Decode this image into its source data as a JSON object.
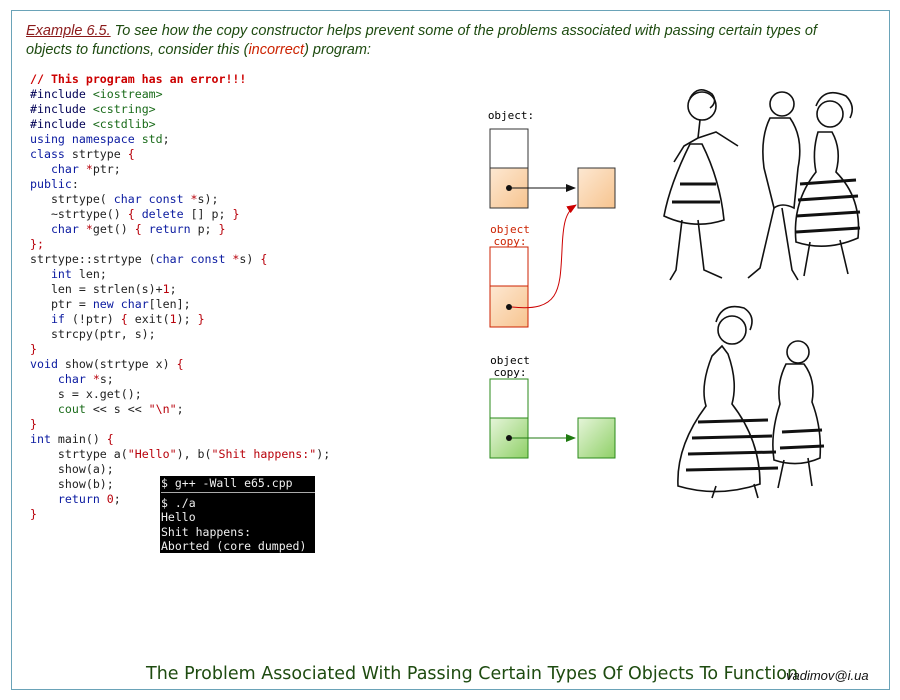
{
  "intro": {
    "example": "Example 6.5.",
    "text_before": " To see how the copy constructor helps prevent some of the problems associated with passing certain types of objects to functions, consider this (",
    "incorrect": "incorrect",
    "text_after": ") program:"
  },
  "code_lines": [
    [
      {
        "c": "c-comment",
        "t": "// This program has an error!!!"
      }
    ],
    [
      {
        "c": "c-pp",
        "t": "#include "
      },
      {
        "c": "c-hdr",
        "t": "<iostream>"
      }
    ],
    [
      {
        "c": "c-pp",
        "t": "#include "
      },
      {
        "c": "c-hdr",
        "t": "<cstring>"
      }
    ],
    [
      {
        "c": "c-pp",
        "t": "#include "
      },
      {
        "c": "c-hdr",
        "t": "<cstdlib>"
      }
    ],
    [
      {
        "c": "c-kw",
        "t": "using namespace "
      },
      {
        "c": "c-hdr",
        "t": "std"
      },
      {
        "c": "",
        "t": ";"
      }
    ],
    [
      {
        "c": "c-kw",
        "t": "class "
      },
      {
        "c": "",
        "t": "strtype "
      },
      {
        "c": "c-str",
        "t": "{"
      }
    ],
    [
      {
        "c": "",
        "t": "   "
      },
      {
        "c": "c-type",
        "t": "char "
      },
      {
        "c": "c-str",
        "t": "*"
      },
      {
        "c": "",
        "t": "ptr;"
      }
    ],
    [
      {
        "c": "c-kw",
        "t": "public"
      },
      {
        "c": "",
        "t": ":"
      }
    ],
    [
      {
        "c": "",
        "t": "   strtype( "
      },
      {
        "c": "c-type",
        "t": "char const "
      },
      {
        "c": "c-str",
        "t": "*"
      },
      {
        "c": "",
        "t": "s);"
      }
    ],
    [
      {
        "c": "",
        "t": "   ~strtype() "
      },
      {
        "c": "c-str",
        "t": "{"
      },
      {
        "c": "c-kw",
        "t": " delete "
      },
      {
        "c": "",
        "t": "[] p; "
      },
      {
        "c": "c-str",
        "t": "}"
      }
    ],
    [
      {
        "c": "",
        "t": "   "
      },
      {
        "c": "c-type",
        "t": "char "
      },
      {
        "c": "c-str",
        "t": "*"
      },
      {
        "c": "",
        "t": "get() "
      },
      {
        "c": "c-str",
        "t": "{"
      },
      {
        "c": "c-kw",
        "t": " return "
      },
      {
        "c": "",
        "t": "p; "
      },
      {
        "c": "c-str",
        "t": "}"
      }
    ],
    [
      {
        "c": "c-str",
        "t": "};"
      }
    ],
    [
      {
        "c": "",
        "t": "strtype::strtype ("
      },
      {
        "c": "c-type",
        "t": "char const "
      },
      {
        "c": "c-str",
        "t": "*"
      },
      {
        "c": "",
        "t": "s) "
      },
      {
        "c": "c-str",
        "t": "{"
      }
    ],
    [
      {
        "c": "",
        "t": "   "
      },
      {
        "c": "c-type",
        "t": "int "
      },
      {
        "c": "",
        "t": "len;"
      }
    ],
    [
      {
        "c": "",
        "t": "   len = strlen(s)+"
      },
      {
        "c": "c-num",
        "t": "1"
      },
      {
        "c": "",
        "t": ";"
      }
    ],
    [
      {
        "c": "",
        "t": "   ptr = "
      },
      {
        "c": "c-kw",
        "t": "new "
      },
      {
        "c": "c-type",
        "t": "char"
      },
      {
        "c": "",
        "t": "[len];"
      }
    ],
    [
      {
        "c": "",
        "t": "   "
      },
      {
        "c": "c-kw",
        "t": "if "
      },
      {
        "c": "",
        "t": "(!ptr) "
      },
      {
        "c": "c-str",
        "t": "{"
      },
      {
        "c": "",
        "t": " exit("
      },
      {
        "c": "c-num",
        "t": "1"
      },
      {
        "c": "",
        "t": "); "
      },
      {
        "c": "c-str",
        "t": "}"
      }
    ],
    [
      {
        "c": "",
        "t": "   strcpy(ptr, s);"
      }
    ],
    [
      {
        "c": "c-str",
        "t": "}"
      }
    ],
    [
      {
        "c": "c-type",
        "t": "void "
      },
      {
        "c": "",
        "t": "show(strtype x) "
      },
      {
        "c": "c-str",
        "t": "{"
      }
    ],
    [
      {
        "c": "",
        "t": "    "
      },
      {
        "c": "c-type",
        "t": "char "
      },
      {
        "c": "c-str",
        "t": "*"
      },
      {
        "c": "",
        "t": "s;"
      }
    ],
    [
      {
        "c": "",
        "t": "    s = x.get();"
      }
    ],
    [
      {
        "c": "",
        "t": "    "
      },
      {
        "c": "c-hdr",
        "t": "cout "
      },
      {
        "c": "",
        "t": "<< s << "
      },
      {
        "c": "c-str",
        "t": "\"\\n\""
      },
      {
        "c": "",
        "t": ";"
      }
    ],
    [
      {
        "c": "c-str",
        "t": "}"
      }
    ],
    [
      {
        "c": "c-type",
        "t": "int "
      },
      {
        "c": "",
        "t": "main() "
      },
      {
        "c": "c-str",
        "t": "{"
      }
    ],
    [
      {
        "c": "",
        "t": "    strtype a("
      },
      {
        "c": "c-str",
        "t": "\"Hello\""
      },
      {
        "c": "",
        "t": "), b("
      },
      {
        "c": "c-str",
        "t": "\"Shit happens:\""
      },
      {
        "c": "",
        "t": ");"
      }
    ],
    [
      {
        "c": "",
        "t": "    show(a);"
      }
    ],
    [
      {
        "c": "",
        "t": "    show(b);"
      }
    ],
    [
      {
        "c": "",
        "t": "    "
      },
      {
        "c": "c-kw",
        "t": "return "
      },
      {
        "c": "c-num",
        "t": "0"
      },
      {
        "c": "",
        "t": ";"
      }
    ],
    [
      {
        "c": "c-str",
        "t": "}"
      }
    ]
  ],
  "terminal": {
    "command": "$ g++ -Wall e65.cpp",
    "lines": [
      "$ ./a",
      "Hello",
      "Shit happens:",
      "Aborted (core dumped)"
    ]
  },
  "diagram": {
    "object_label": "object:",
    "copy1_label_line1": "object",
    "copy1_label_line2": "copy:",
    "copy2_label_line1": "object",
    "copy2_label_line2": "copy:"
  },
  "footer": {
    "title": "The Problem Associated With Passing Certain Types Of Objects To Function",
    "email": "vadimov@i.ua"
  },
  "colors": {
    "title_green": "#1e4b10",
    "orange_fill": "#fbd9b8",
    "red_outline": "#cc2200",
    "green_fill": "#b8e0a0",
    "green_outline": "#2a8a1a"
  }
}
